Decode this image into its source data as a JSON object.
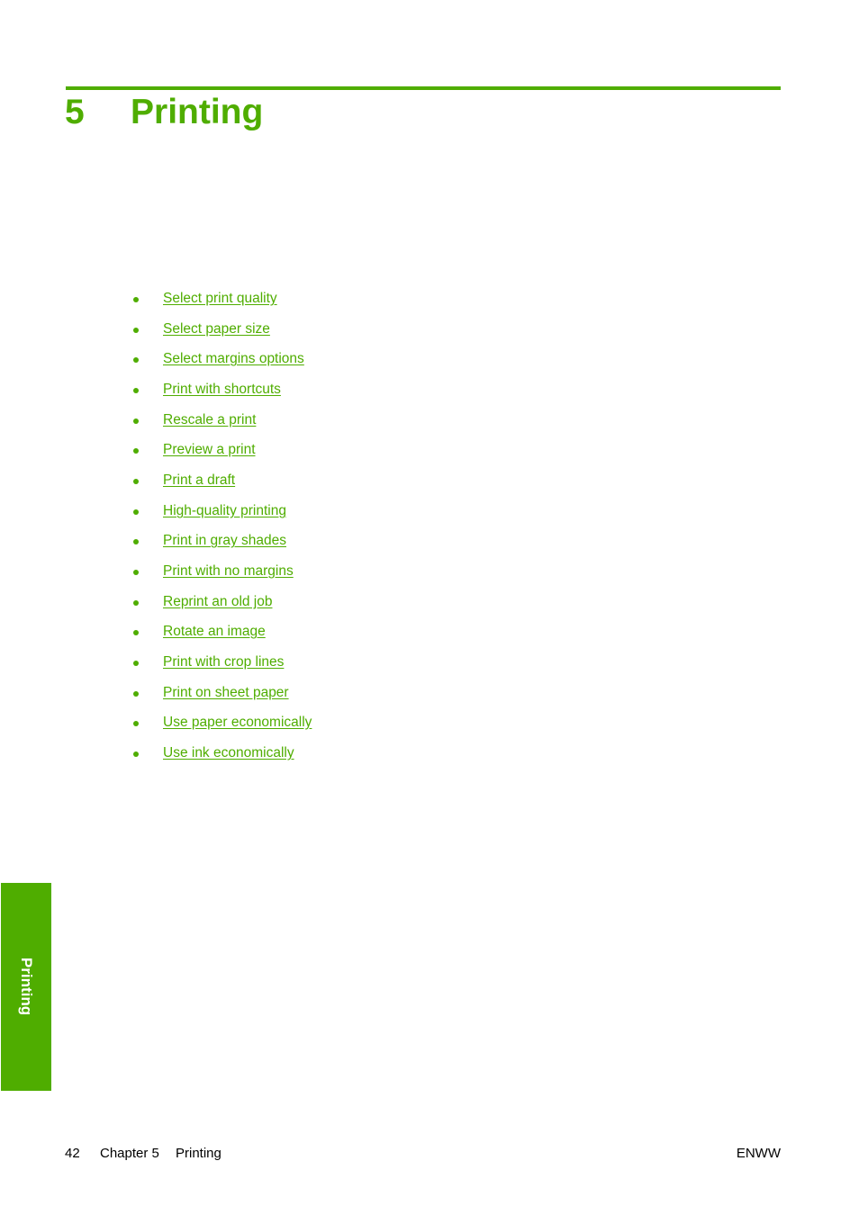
{
  "chapter": {
    "number": "5",
    "title": "Printing"
  },
  "toc": {
    "items": [
      {
        "label": "Select print quality"
      },
      {
        "label": "Select paper size"
      },
      {
        "label": "Select margins options"
      },
      {
        "label": "Print with shortcuts"
      },
      {
        "label": "Rescale a print"
      },
      {
        "label": "Preview a print"
      },
      {
        "label": "Print a draft"
      },
      {
        "label": "High-quality printing"
      },
      {
        "label": "Print in gray shades"
      },
      {
        "label": "Print with no margins"
      },
      {
        "label": "Reprint an old job"
      },
      {
        "label": "Rotate an image"
      },
      {
        "label": "Print with crop lines"
      },
      {
        "label": "Print on sheet paper"
      },
      {
        "label": "Use paper economically"
      },
      {
        "label": "Use ink economically"
      }
    ]
  },
  "side_tab": {
    "label": "Printing"
  },
  "footer": {
    "page_number": "42",
    "chapter_label": "Chapter 5",
    "section_label": "Printing",
    "locale": "ENWW"
  },
  "colors": {
    "accent": "#4fad00",
    "text": "#000000",
    "background": "#ffffff"
  }
}
